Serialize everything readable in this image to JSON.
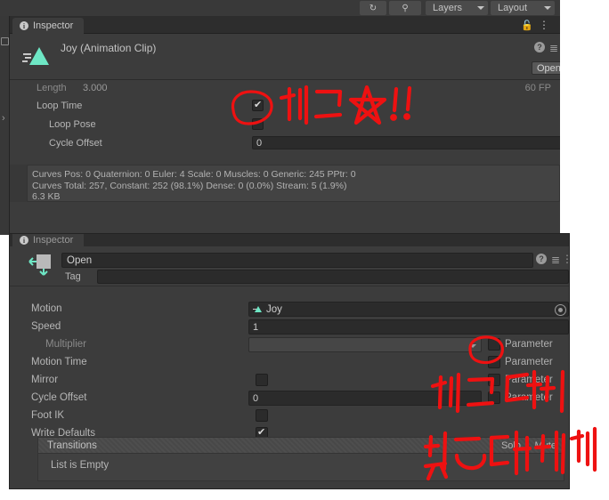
{
  "toolbar": {
    "history_icon": "history-icon",
    "search_icon": "search-icon",
    "layers_label": "Layers",
    "layout_label": "Layout"
  },
  "top_panel": {
    "tab_label": "Inspector",
    "lock_icon": "lock-icon",
    "kebab_icon": "kebab-menu-icon",
    "clip_title": "Joy (Animation Clip)",
    "help_icon": "help-icon",
    "preset_icon": "preset-icon",
    "open_button": "Open",
    "fps_label": "60 FP",
    "rows": [
      {
        "label": "Length",
        "value": "3.000",
        "type": "readonly"
      },
      {
        "label": "Loop Time",
        "value": "",
        "type": "checkbox",
        "checked": true
      },
      {
        "label": "Loop Pose",
        "value": "",
        "type": "checkbox",
        "checked": false
      },
      {
        "label": "Cycle Offset",
        "value": "0",
        "type": "text"
      }
    ],
    "curves_info": [
      "Curves Pos: 0 Quaternion: 0 Euler: 4 Scale: 0 Muscles: 0 Generic: 245 PPtr: 0",
      "Curves Total: 257, Constant: 252 (98.1%) Dense: 0 (0.0%) Stream: 5 (1.9%)",
      "6.3 KB"
    ]
  },
  "bottom_panel": {
    "tab_label": "Inspector",
    "state_name": "Open",
    "tag_label": "Tag",
    "tag_value": "",
    "help_icon": "help-icon",
    "preset_icon": "preset-icon",
    "kebab_icon": "kebab-menu-icon",
    "fields": [
      {
        "label": "Motion",
        "value": "Joy",
        "type": "object"
      },
      {
        "label": "Speed",
        "value": "1",
        "type": "text"
      },
      {
        "label": "Multiplier",
        "value": "",
        "type": "dropdown",
        "dimmed": true,
        "parameter": "Parameter",
        "param_checked": false
      },
      {
        "label": "Motion Time",
        "value": "",
        "type": "none",
        "parameter": "Parameter",
        "param_checked": false
      },
      {
        "label": "Mirror",
        "value": "",
        "type": "checkbox",
        "checked": false,
        "parameter": "Parameter",
        "param_checked": false
      },
      {
        "label": "Cycle Offset",
        "value": "0",
        "type": "text",
        "parameter": "Parameter",
        "param_checked": false
      },
      {
        "label": "Foot IK",
        "value": "",
        "type": "checkbox",
        "checked": false
      },
      {
        "label": "Write Defaults",
        "value": "",
        "type": "checkbox",
        "checked": true
      }
    ],
    "transitions": {
      "header": "Transitions",
      "solo": "Solo",
      "mute": "Mute",
      "empty_text": "List is Empty"
    }
  },
  "annotations": {
    "top_note": "체크☆!!",
    "bottom_note_line1": "체크 되어",
    "bottom_note_line2": "있으면 해제",
    "ink_color": "#ee1111"
  }
}
